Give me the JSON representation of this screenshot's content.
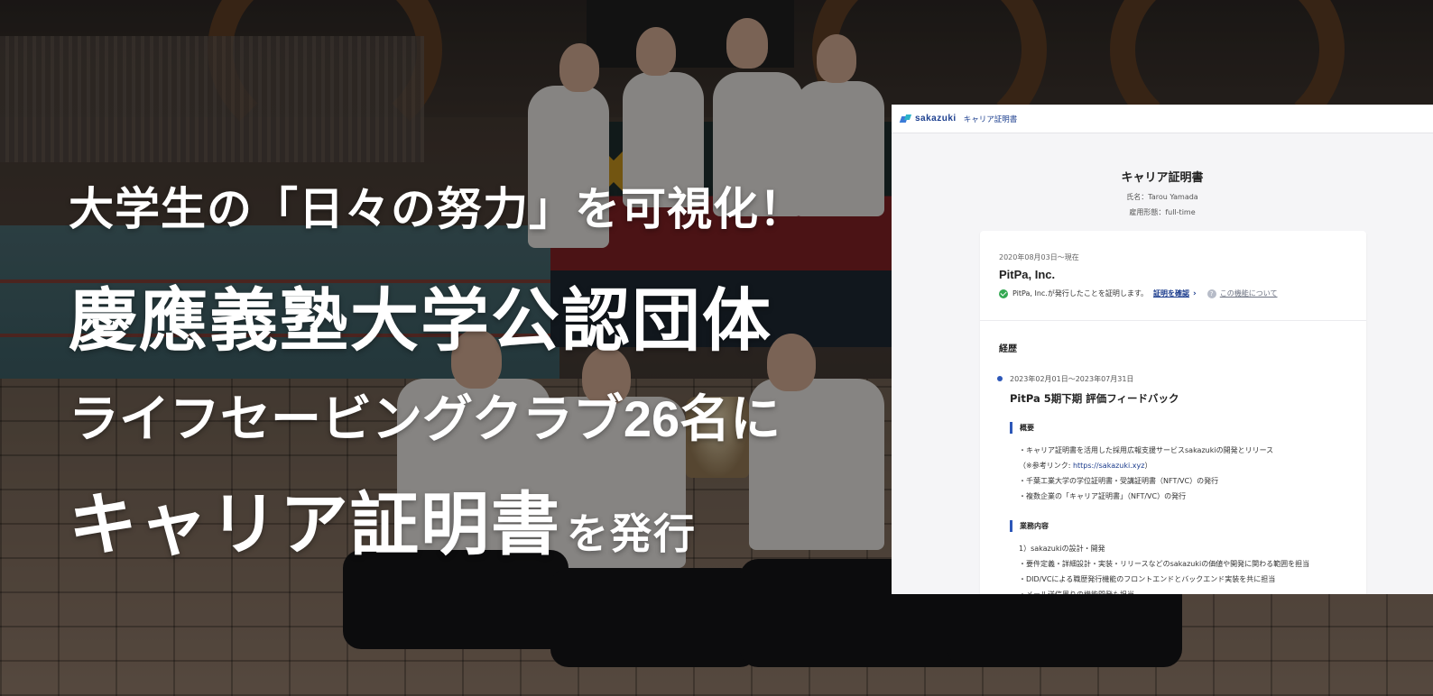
{
  "headline": {
    "line1": "大学生の「日々の努力」を可視化！",
    "line2": "慶應義塾大学公認団体",
    "line3": "ライフセービングクラブ26名に",
    "line4_main": "キャリア証明書",
    "line4_suffix": "を発行"
  },
  "certificate": {
    "topbar": {
      "logo": "sakazuki",
      "label": "キャリア証明書"
    },
    "title": "キャリア証明書",
    "name_label": "氏名：Tarou Yamada",
    "employment_label": "雇用形態：full-time",
    "company": {
      "period": "2020年08月03日〜現在",
      "name": "PitPa, Inc.",
      "verified_text": "PitPa, Inc.が発行したことを証明します。",
      "verify_link": "証明を確認",
      "about_link": "この機能について"
    },
    "history": {
      "section_title": "経歴",
      "entry": {
        "period": "2023年02月01日〜2023年07月31日",
        "title": "PitPa 5期下期 評価フィードバック",
        "overview_title": "概要",
        "overview_lines": [
          "・キャリア証明書を活用した採用広報支援サービスsakazukiの開発とリリース",
          "・千葉工業大学の学位証明書・受講証明書（NFT/VC）の発行",
          "・複数企業の「キャリア証明書」（NFT/VC）の発行"
        ],
        "reference_prefix": "（※参考リンク: ",
        "reference_link": "https://sakazuki.xyz",
        "reference_suffix": "）",
        "work_title": "業務内容",
        "work_lines": [
          "1）sakazukiの設計・開発",
          "・要件定義・詳細設計・実装・リリースなどのsakazukiの価値や開発に関わる範囲を担当",
          "・DID/VCによる職歴発行機能のフロントエンドとバックエンド実装を共に担当",
          "・メール送信周りの機能開発も担当"
        ]
      }
    }
  },
  "colors": {
    "accent": "#2d57b8",
    "verified": "#33a852",
    "brand": "#1c3f8f"
  }
}
